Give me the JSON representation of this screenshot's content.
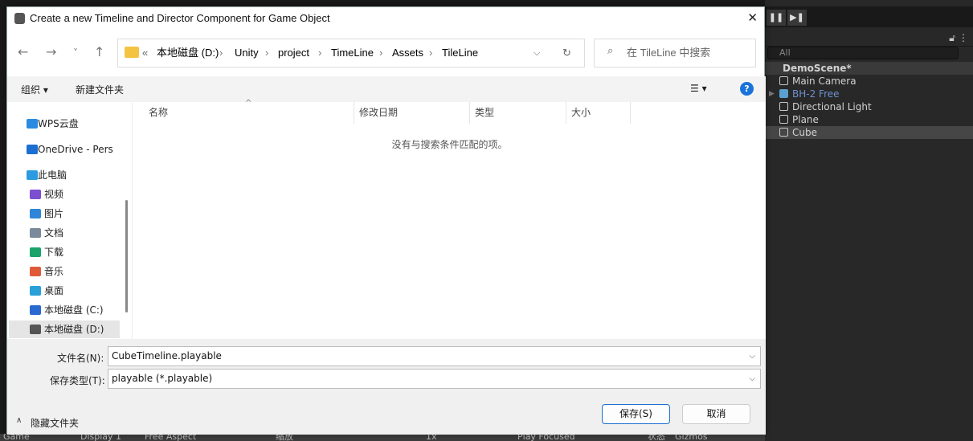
{
  "dialog": {
    "title": "Create a new Timeline and Director Component for Game Object",
    "close": "✕",
    "nav": {
      "back": "←",
      "forward": "→",
      "recent": "˅",
      "up": "↑"
    },
    "address": {
      "overflow": "«",
      "segments": [
        "本地磁盘 (D:)",
        "Unity",
        "project",
        "TimeLine",
        "Assets",
        "TileLine"
      ]
    },
    "search_placeholder": "在 TileLine 中搜索",
    "toolbar": {
      "organize": "组织 ▾",
      "new_folder": "新建文件夹",
      "view": "☰ ▾",
      "help": "?"
    },
    "sidebar": [
      {
        "label": "WPS云盘",
        "icon": "cloud-icon",
        "color": "#2b8be0"
      },
      {
        "label": "OneDrive - Pers",
        "icon": "onedrive-icon",
        "color": "#1a6fd0"
      },
      {
        "label": "此电脑",
        "icon": "computer-icon",
        "color": "#2a9be0"
      },
      {
        "label": "视频",
        "icon": "video-icon",
        "color": "#7b4fd0"
      },
      {
        "label": "图片",
        "icon": "pictures-icon",
        "color": "#2f86d8"
      },
      {
        "label": "文档",
        "icon": "documents-icon",
        "color": "#7a8a9a"
      },
      {
        "label": "下载",
        "icon": "download-icon",
        "color": "#1aa36a"
      },
      {
        "label": "音乐",
        "icon": "music-icon",
        "color": "#e05a3a"
      },
      {
        "label": "桌面",
        "icon": "desktop-icon",
        "color": "#2aa0d8"
      },
      {
        "label": "本地磁盘 (C:)",
        "icon": "windows-drive-icon",
        "color": "#2a6ad0"
      },
      {
        "label": "本地磁盘 (D:)",
        "icon": "drive-icon",
        "color": "#555555",
        "selected": true
      }
    ],
    "columns": [
      "名称",
      "修改日期",
      "类型",
      "大小"
    ],
    "empty_message": "没有与搜索条件匹配的项。",
    "filename_label": "文件名(N):",
    "filename_value": "CubeTimeline.playable",
    "filetype_label": "保存类型(T):",
    "filetype_value": "playable (*.playable)",
    "hide_folders": "隐藏文件夹",
    "save": "保存(S)",
    "cancel": "取消"
  },
  "unity": {
    "hierarchy": {
      "search": "All",
      "scene": "DemoScene*",
      "items": [
        {
          "label": "Main Camera"
        },
        {
          "label": "BH-2 Free",
          "prefab": true
        },
        {
          "label": "Directional Light"
        },
        {
          "label": "Plane"
        },
        {
          "label": "Cube",
          "selected": true
        }
      ]
    },
    "game_bar": {
      "tab": "Game",
      "display": "Display 1",
      "aspect": "Free Aspect",
      "scale_label": "缩放",
      "scale": "1x",
      "play_mode": "Play Focused",
      "stats": "状态",
      "gizmos": "Gizmos"
    }
  }
}
